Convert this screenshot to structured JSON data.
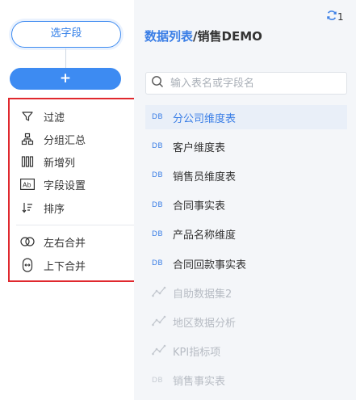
{
  "left": {
    "select_field_label": "选字段",
    "add_label": "+",
    "menu": [
      {
        "label": "过滤",
        "icon": "filter-icon"
      },
      {
        "label": "分组汇总",
        "icon": "group-summary-icon"
      },
      {
        "label": "新增列",
        "icon": "add-column-icon"
      },
      {
        "label": "字段设置",
        "icon": "field-settings-icon"
      },
      {
        "label": "排序",
        "icon": "sort-icon"
      },
      {
        "label": "左右合并",
        "icon": "merge-horizontal-icon"
      },
      {
        "label": "上下合并",
        "icon": "merge-vertical-icon"
      }
    ]
  },
  "right": {
    "refresh_count": "1",
    "title_blue": "数据列表",
    "title_rest": "/销售DEMO",
    "search_placeholder": "输入表名或字段名",
    "tables": [
      {
        "label": "分公司维度表",
        "icon": "DB",
        "state": "active"
      },
      {
        "label": "客户维度表",
        "icon": "DB",
        "state": "normal"
      },
      {
        "label": "销售员维度表",
        "icon": "DB",
        "state": "normal"
      },
      {
        "label": "合同事实表",
        "icon": "DB",
        "state": "normal"
      },
      {
        "label": "产品名称维度",
        "icon": "DB",
        "state": "normal"
      },
      {
        "label": "合同回款事实表",
        "icon": "DB",
        "state": "normal"
      },
      {
        "label": "自助数据集2",
        "icon": "self-service-dataset-icon",
        "state": "disabled"
      },
      {
        "label": "地区数据分析",
        "icon": "self-service-dataset-icon",
        "state": "disabled"
      },
      {
        "label": "KPI指标项",
        "icon": "self-service-dataset-icon",
        "state": "disabled"
      },
      {
        "label": "销售事实表",
        "icon": "DB",
        "state": "disabled"
      }
    ]
  },
  "colors": {
    "accent": "#3d8bf2",
    "highlight_border": "#e0282e",
    "panel_bg": "#f4f6f9"
  }
}
